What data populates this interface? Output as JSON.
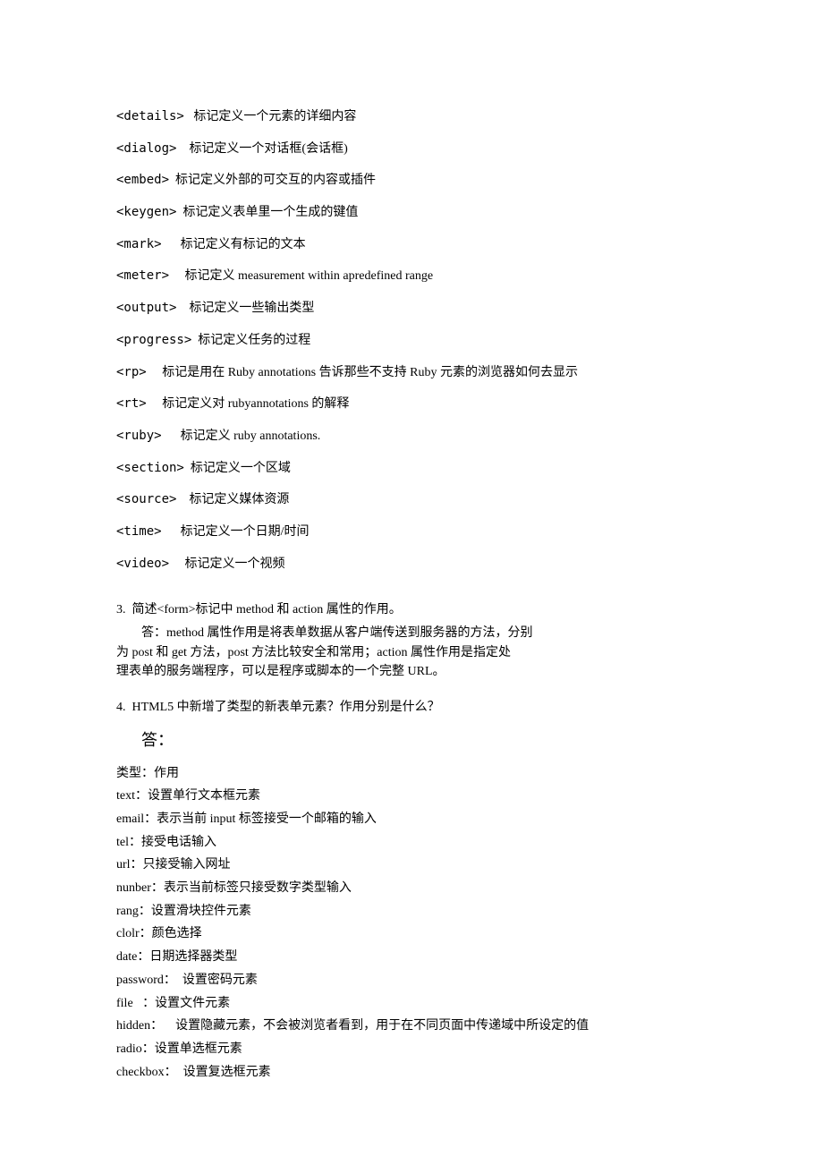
{
  "tags": [
    {
      "tag": "<details>",
      "desc": "标记定义一个元素的详细内容",
      "sp": "   "
    },
    {
      "tag": "<dialog>",
      "desc": "标记定义一个对话框(会话框)",
      "sp": "    "
    },
    {
      "tag": "<embed>",
      "desc": "标记定义外部的可交互的内容或插件",
      "sp": "  "
    },
    {
      "tag": "<keygen>",
      "desc": "标记定义表单里一个生成的键值",
      "sp": "  "
    },
    {
      "tag": "<mark>",
      "desc": "标记定义有标记的文本",
      "sp": "      "
    },
    {
      "tag": "<meter>",
      "desc": "标记定义 measurement within apredefined range",
      "sp": "     "
    },
    {
      "tag": "<output>",
      "desc": "标记定义一些输出类型",
      "sp": "    "
    },
    {
      "tag": "<progress>",
      "desc": "标记定义任务的过程",
      "sp": "  "
    },
    {
      "tag": "<rp>",
      "desc": "标记是用在 Ruby annotations 告诉那些不支持 Ruby 元素的浏览器如何去显示",
      "sp": "     "
    },
    {
      "tag": "<rt>",
      "desc": "标记定义对 rubyannotations 的解释",
      "sp": "     "
    },
    {
      "tag": "<ruby>",
      "desc": "标记定义 ruby annotations.",
      "sp": "      "
    },
    {
      "tag": "<section>",
      "desc": "标记定义一个区域",
      "sp": "  "
    },
    {
      "tag": "<source>",
      "desc": "标记定义媒体资源",
      "sp": "    "
    },
    {
      "tag": "<time>",
      "desc": "标记定义一个日期/时间",
      "sp": "      "
    },
    {
      "tag": "<video>",
      "desc": "标记定义一个视频",
      "sp": "     "
    }
  ],
  "q3": {
    "question": "3.  简述<form>标记中 method 和 action 属性的作用。",
    "answer1": "答：method 属性作用是将表单数据从客户端传送到服务器的方法，分别",
    "answer2": "为 post 和 get 方法，post 方法比较安全和常用；action 属性作用是指定处",
    "answer3": "理表单的服务端程序，可以是程序或脚本的一个完整 URL。"
  },
  "q4": {
    "question": "4.  HTML5 中新增了类型的新表单元素？作用分别是什么？",
    "answerLabel": "答：",
    "header": "类型：作用",
    "types": [
      "text：设置单行文本框元素",
      "email：表示当前 input 标签接受一个邮箱的输入",
      "tel：接受电话输入",
      "url：只接受输入网址",
      "nunber：表示当前标签只接受数字类型输入",
      "rang：设置滑块控件元素",
      "clolr：颜色选择",
      "date：日期选择器类型",
      "password：  设置密码元素",
      "file   ：设置文件元素",
      "hidden：    设置隐藏元素，不会被浏览者看到，用于在不同页面中传递域中所设定的值",
      "radio：设置单选框元素",
      "checkbox：  设置复选框元素"
    ]
  }
}
